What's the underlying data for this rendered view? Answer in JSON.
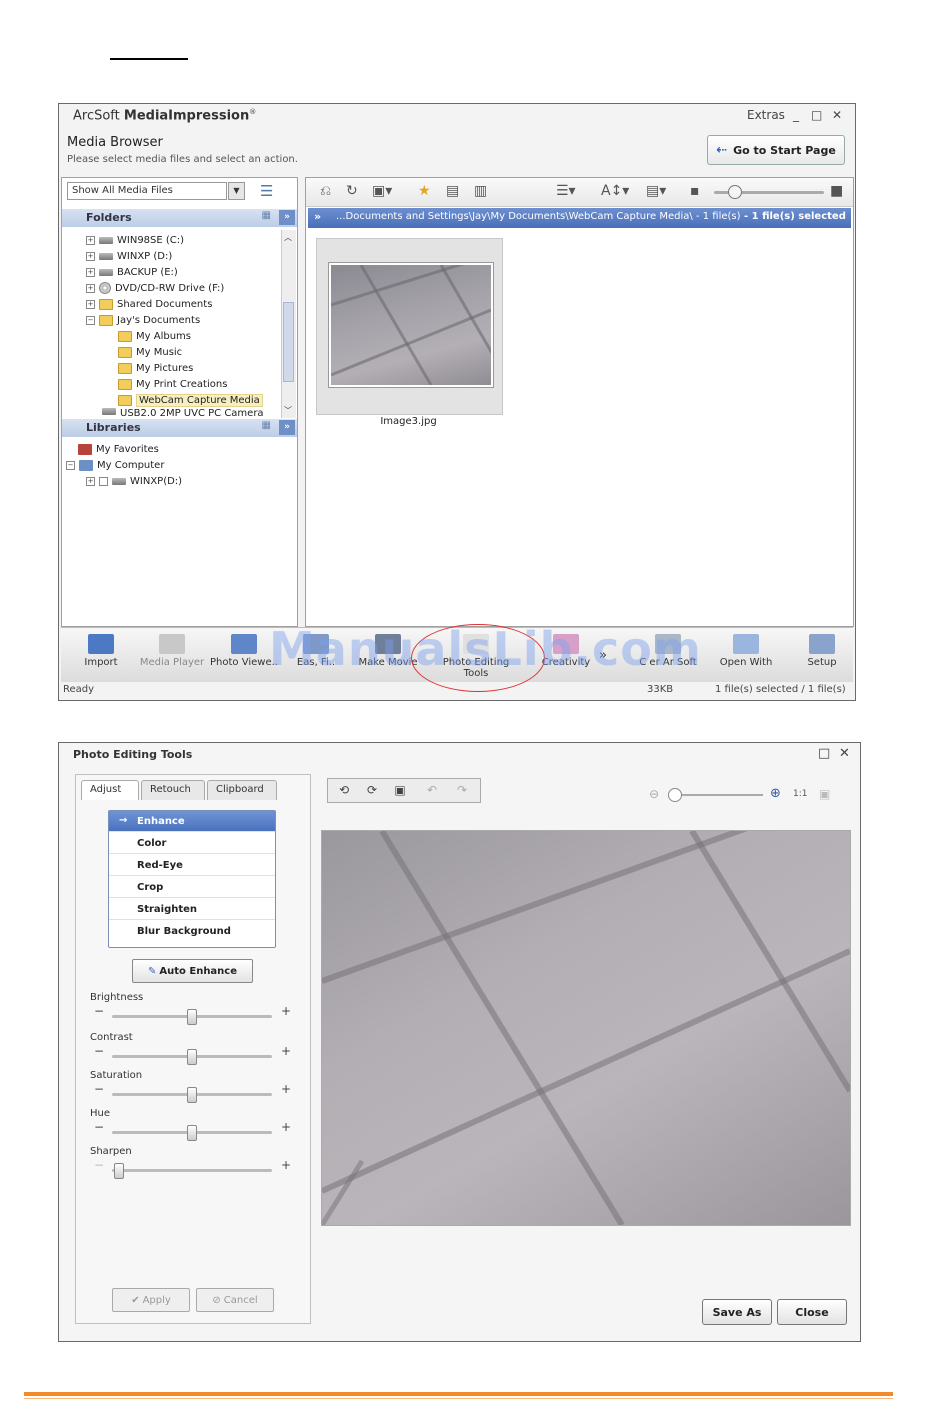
{
  "media_window": {
    "app_title_prefix": "ArcSoft ",
    "app_title_bold": "MediaImpression",
    "app_title_mark": "®",
    "extras": "Extras",
    "section_title": "Media Browser",
    "section_subtitle": "Please select media files and select an action.",
    "go_to_start": "Go to Start Page",
    "filter_value": "Show All Media Files",
    "folders_label": "Folders",
    "libraries_label": "Libraries",
    "tree": [
      {
        "label": "WIN98SE (C:)",
        "icon": "drive-icon"
      },
      {
        "label": "WINXP (D:)",
        "icon": "drive-icon"
      },
      {
        "label": "BACKUP (E:)",
        "icon": "drive-icon"
      },
      {
        "label": "DVD/CD-RW Drive (F:)",
        "icon": "cd-drive-icon"
      },
      {
        "label": "Shared Documents",
        "icon": "folder-icon"
      },
      {
        "label": "Jay's Documents",
        "icon": "folder-icon"
      },
      {
        "label": "My Albums",
        "icon": "folder-icon"
      },
      {
        "label": "My Music",
        "icon": "folder-icon"
      },
      {
        "label": "My Pictures",
        "icon": "folder-icon"
      },
      {
        "label": "My Print Creations",
        "icon": "folder-icon"
      },
      {
        "label": "WebCam Capture Media",
        "icon": "folder-icon"
      },
      {
        "label": "USB2.0 2MP UVC PC Camera",
        "icon": "camera-icon"
      }
    ],
    "libraries": [
      {
        "label": "My Favorites",
        "icon": "favorites-icon"
      },
      {
        "label": "My Computer",
        "icon": "computer-icon"
      },
      {
        "label": "WINXP(D:)",
        "icon": "drive-icon"
      }
    ],
    "path_bar": "...Documents and Settings\\Jay\\My Documents\\WebCam Capture Media\\ - 1 file(s)",
    "path_selected": " - 1 file(s) selected",
    "thumbnail_caption": "Image3.jpg",
    "actions": [
      "Import",
      "Media Player",
      "Photo Viewer",
      "Easy Fix",
      "Make Movie",
      "Photo Editing Tools",
      "Creativity",
      "ArcSoft",
      "Open With",
      "Setup"
    ],
    "actions_shown": [
      "Import",
      "Media Player",
      "Photo Viewe..",
      "Eas, Fi..",
      "Make Movie",
      "Photo Editing Tools",
      "Creativity",
      "C er Ar Soft",
      "Open With",
      "Setup"
    ],
    "watermark": "ManualsLib.com",
    "status_ready": "Ready",
    "status_size": "33KB",
    "status_files": "1 file(s) selected / 1 file(s)"
  },
  "edit_window": {
    "title": "Photo Editing Tools",
    "tabs": [
      "Adjust",
      "Retouch",
      "Clipboard"
    ],
    "menu_items": [
      "Enhance",
      "Color",
      "Red-Eye",
      "Crop",
      "Straighten",
      "Blur Background"
    ],
    "auto_enhance": "Auto Enhance",
    "sliders": [
      {
        "label": "Brightness",
        "value": 0.5
      },
      {
        "label": "Contrast",
        "value": 0.5
      },
      {
        "label": "Saturation",
        "value": 0.5
      },
      {
        "label": "Hue",
        "value": 0.5
      },
      {
        "label": "Sharpen",
        "value": 0.05
      }
    ],
    "apply": "Apply",
    "cancel": "Cancel",
    "zoom_ratio": "1:1",
    "save_as": "Save As",
    "close": "Close"
  },
  "colors": {
    "accent_blue": "#4a6fb8",
    "footer_orange": "#f08a2a",
    "annotation_red": "#dd3333"
  }
}
